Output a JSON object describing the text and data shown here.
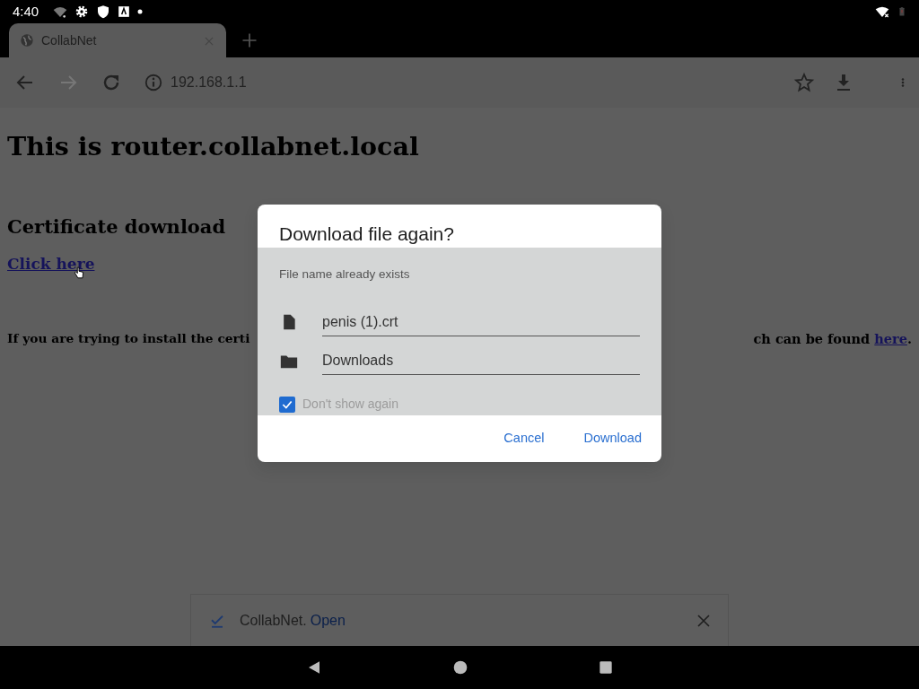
{
  "status_bar": {
    "time": "4:40"
  },
  "tabs": [
    {
      "label": "CollabNet",
      "selected": true
    }
  ],
  "toolbar": {
    "url": "192.168.1.1"
  },
  "page": {
    "heading": "This is router.collabnet.local",
    "subheading": "Certificate download",
    "link": "Click here",
    "paragraph_left": "If you are trying to install the certi",
    "paragraph_right": "ch can be found",
    "paragraph_link": "here",
    "paragraph_end": "."
  },
  "dialog": {
    "title": "Download file again?",
    "message": "File name already exists",
    "fields": [
      {
        "kind": "file",
        "value": "penis (1).crt"
      },
      {
        "kind": "folder",
        "value": "Downloads"
      }
    ],
    "checkbox": {
      "label": "Don't show again",
      "checked": true
    },
    "buttons": [
      "Cancel",
      "Download"
    ]
  },
  "download_bar": {
    "name": "CollabNet.",
    "action": "Open"
  }
}
